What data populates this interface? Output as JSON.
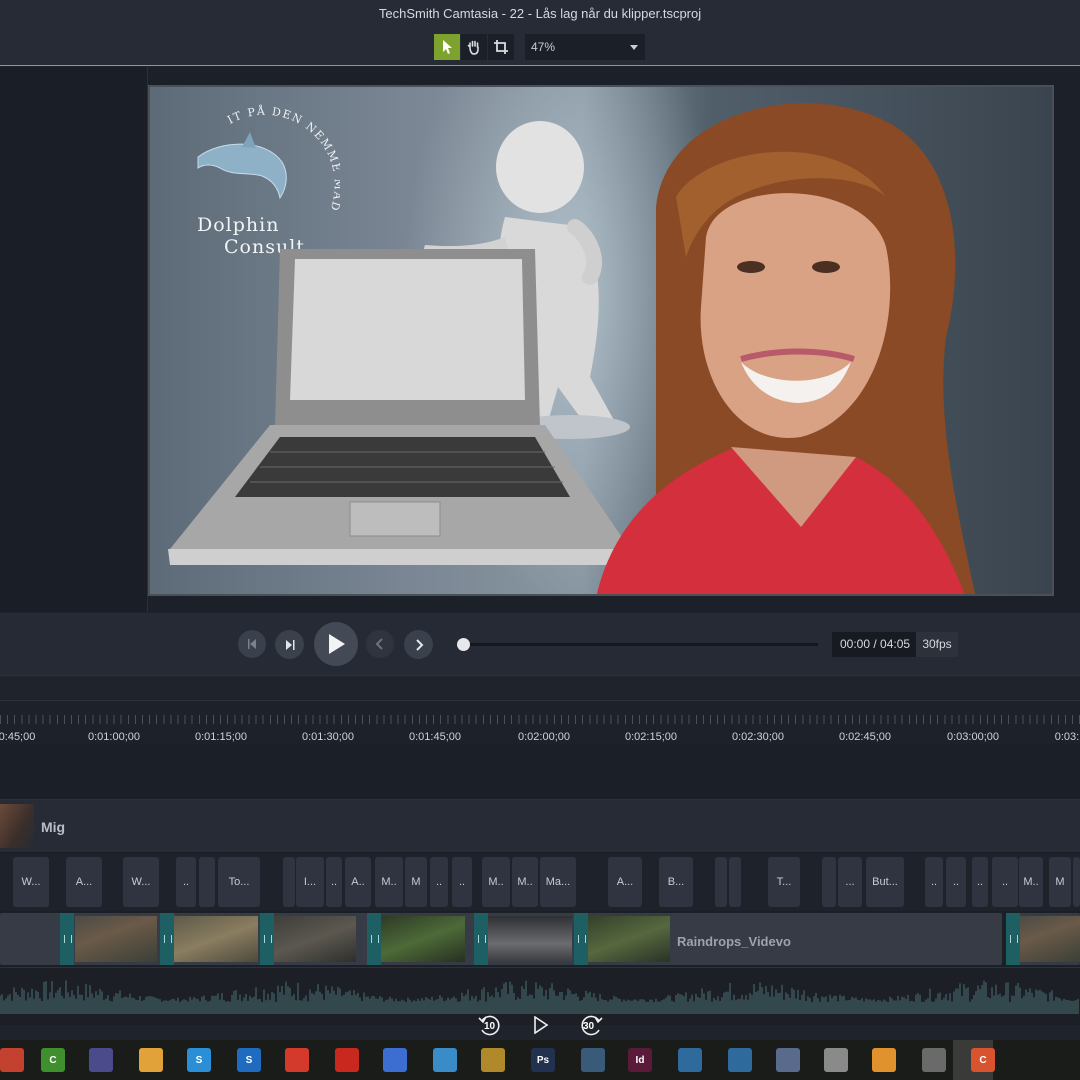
{
  "window": {
    "title": "TechSmith Camtasia - 22 - Lås lag når du klipper.tscproj"
  },
  "toolbar": {
    "tools": [
      "pointer-tool",
      "pan-tool",
      "crop-tool"
    ],
    "zoom": "47%"
  },
  "preview": {
    "logo_tagline": "IT PÅ DEN NEMME MÅDE",
    "logo_line1": "Dolphin",
    "logo_line2": "Consult"
  },
  "playback": {
    "time": "00:00 / 04:05",
    "fps": "30fps",
    "progress": 0.0
  },
  "ruler": {
    "labels": [
      "0:45;00",
      "0:01:00;00",
      "0:01:15;00",
      "0:01:30;00",
      "0:01:45;00",
      "0:02:00;00",
      "0:02:15;00",
      "0:02:30;00",
      "0:02:45;00",
      "0:03:00;00",
      "0:03:1"
    ]
  },
  "tracks": {
    "mig_label": "Mig",
    "annotation_clips": [
      "W...",
      "A...",
      "W...",
      "..",
      "",
      "To...",
      "",
      "I...",
      "..",
      "A..",
      "M..",
      "M",
      "..",
      "..",
      "M..",
      "M..",
      "Ma...",
      "A...",
      "B...",
      "",
      "",
      "T...",
      "",
      "...",
      "But...",
      "..",
      "..",
      "..",
      "..",
      "M..",
      "M",
      ""
    ],
    "video_label": "Raindrops_Videvo"
  },
  "overlay": {
    "rewind_label": "10",
    "forward_label": "30"
  },
  "taskbar": {
    "icons": [
      "file-icon",
      "camtasia-icon",
      "audio-icon",
      "notes-icon",
      "skype-icon",
      "skype-business-icon",
      "acrobat-icon",
      "acrobat-dc-icon",
      "zoom-icon",
      "network-icon",
      "media-icon",
      "photoshop-icon",
      "camera-raw-icon",
      "indesign-icon",
      "vpn-icon",
      "vpn2-icon",
      "remote-icon",
      "character-icon",
      "video-icon",
      "clapper-icon",
      "camtasia-active-icon"
    ]
  }
}
